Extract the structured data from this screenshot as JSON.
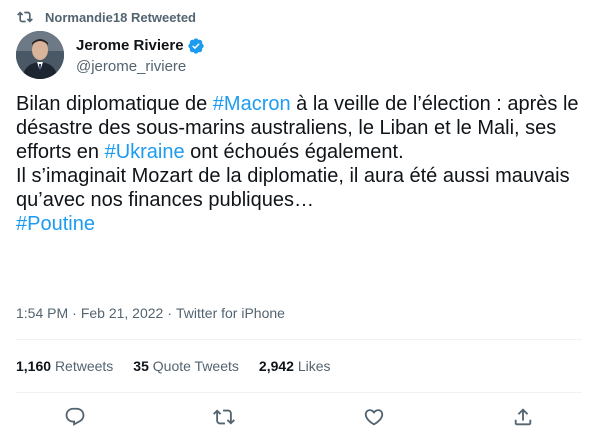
{
  "retweet": {
    "text": "Normandie18 Retweeted",
    "icon": "retweet-icon"
  },
  "author": {
    "display_name": "Jerome Riviere",
    "handle": "@jerome_riviere",
    "verified": true
  },
  "tweet": {
    "line1_a": "Bilan diplomatique de ",
    "tag_macron": "#Macron",
    "line1_b": " à la veille de l’élection : après le désastre des sous-marins australiens, le Liban et le Mali, ses efforts en ",
    "tag_ukraine": "#Ukraine",
    "line1_c": " ont échoués également.",
    "line2": "Il s’imaginait Mozart de la diplomatie, il aura été aussi mauvais qu’avec nos finances publiques…",
    "tag_poutine": "#Poutine"
  },
  "meta": {
    "time": "1:54 PM",
    "date": "Feb 21, 2022",
    "source": "Twitter for iPhone",
    "separator": "·"
  },
  "stats": {
    "retweets_count": "1,160",
    "retweets_label": "Retweets",
    "quotes_count": "35",
    "quotes_label": "Quote Tweets",
    "likes_count": "2,942",
    "likes_label": "Likes"
  },
  "colors": {
    "accent": "#1d9bf0",
    "text": "#0f1419",
    "secondary": "#536471",
    "divider": "#eff3f4"
  }
}
